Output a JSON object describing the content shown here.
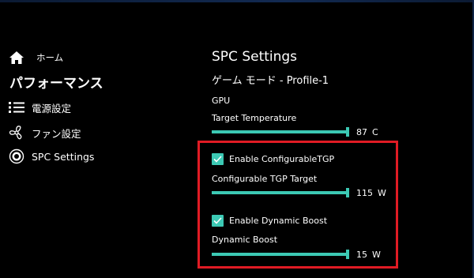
{
  "colors": {
    "accent": "#3cc9b4",
    "highlight": "#e01b24",
    "background": "#000000",
    "track": "#555555"
  },
  "sidebar": {
    "items": [
      {
        "label": "ホーム",
        "icon": "home-icon"
      },
      {
        "label": "パフォーマンス",
        "icon": ""
      },
      {
        "label": "電源設定",
        "icon": "list-icon"
      },
      {
        "label": "ファン設定",
        "icon": "fan-icon"
      },
      {
        "label": "SPC Settings",
        "icon": "gauge-icon"
      }
    ]
  },
  "main": {
    "title": "SPC Settings",
    "subtitle": "ゲーム モード - Profile-1",
    "gpu_section": "GPU",
    "target_temperature": {
      "label": "Target Temperature",
      "value": "87",
      "unit": "C",
      "fraction": 1.0
    },
    "configurable_tgp": {
      "checkbox_label": "Enable ConfigurableTGP",
      "checked": true,
      "label": "Configurable TGP Target",
      "value": "115",
      "unit": "W",
      "fraction": 1.0
    },
    "dynamic_boost": {
      "checkbox_label": "Enable Dynamic Boost",
      "checked": true,
      "label": "Dynamic Boost",
      "value": "15",
      "unit": "W",
      "fraction": 1.0
    }
  }
}
